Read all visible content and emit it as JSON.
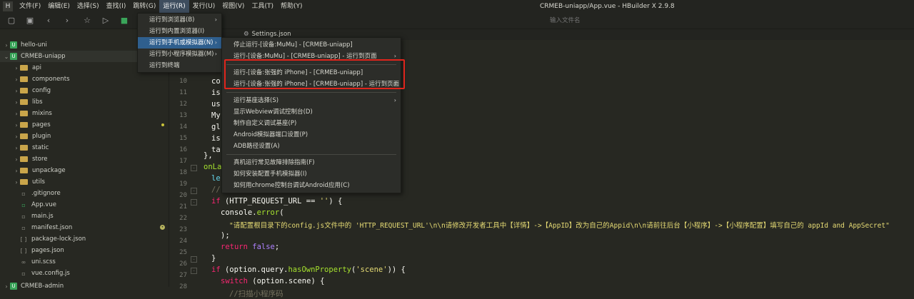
{
  "window_title": "CRMEB-uniapp/App.vue - HBuilder X 2.9.8",
  "menubar": {
    "logo": "H",
    "items": [
      "文件(F)",
      "编辑(E)",
      "选择(S)",
      "查找(I)",
      "跳转(G)",
      "运行(R)",
      "发行(U)",
      "视图(V)",
      "工具(T)",
      "帮助(Y)"
    ]
  },
  "toolbar": {
    "search_placeholder": "输入文件名"
  },
  "editor_tab": {
    "label": "Settings.json"
  },
  "sidebar": {
    "items": [
      {
        "label": "hello-uni",
        "type": "project"
      },
      {
        "label": "CRMEB-uniapp",
        "type": "project"
      },
      {
        "label": "api",
        "type": "folder"
      },
      {
        "label": "components",
        "type": "folder"
      },
      {
        "label": "config",
        "type": "folder"
      },
      {
        "label": "libs",
        "type": "folder"
      },
      {
        "label": "mixins",
        "type": "folder"
      },
      {
        "label": "pages",
        "type": "folder"
      },
      {
        "label": "plugin",
        "type": "folder"
      },
      {
        "label": "static",
        "type": "folder"
      },
      {
        "label": "store",
        "type": "folder"
      },
      {
        "label": "unpackage",
        "type": "folder"
      },
      {
        "label": "utils",
        "type": "folder"
      },
      {
        "label": ".gitignore",
        "type": "file"
      },
      {
        "label": "App.vue",
        "type": "file"
      },
      {
        "label": "main.js",
        "type": "file"
      },
      {
        "label": "manifest.json",
        "type": "file"
      },
      {
        "label": "package-lock.json",
        "type": "file"
      },
      {
        "label": "pages.json",
        "type": "file"
      },
      {
        "label": "uni.scss",
        "type": "file"
      },
      {
        "label": "vue.config.js",
        "type": "file"
      },
      {
        "label": "CRMEB-admin",
        "type": "project"
      }
    ]
  },
  "gutter": {
    "numbers": [
      "10",
      "11",
      "12",
      "13",
      "14",
      "15",
      "16",
      "17",
      "18",
      "19",
      "20",
      "21",
      "22",
      "23",
      "24",
      "25",
      "26",
      "27",
      "28",
      "29"
    ]
  },
  "code": {
    "l10": "co",
    "l11": "is",
    "l12": "us",
    "l13": "My",
    "l14": "gl",
    "l15": "is",
    "l16": "ta",
    "l17": "},",
    "l18": "onLa",
    "l19": "le",
    "l20": "//",
    "l21_kw": "if",
    "l21_a": " (HTTP_REQUEST_URL == ",
    "l21_str": "''",
    "l21_b": ") {",
    "l22_a": "console.",
    "l22_fn": "error",
    "l22_b": "(",
    "l23_str": "\"请配置根目录下的config.js文件中的 'HTTP_REQUEST_URL'\\n\\n请修改开发者工具中【详情】->【AppID】改为自己的Appid\\n\\n请前往后台【小程序】->【小程序配置】填写自己的 appId and AppSecret\"",
    "l24": ");",
    "l25_kw": "return",
    "l25_bool": " false",
    "l25_b": ";",
    "l26": "}",
    "l27_kw": "if",
    "l27_a": " (option.query.",
    "l27_fn": "hasOwnProperty",
    "l27_b": "(",
    "l27_str": "'scene'",
    "l27_c": ")) {",
    "l28_kw": "switch",
    "l28_a": " (option.scene) {",
    "l29_cmt": "//扫描小程序码"
  },
  "run_menu": {
    "items": [
      "运行到浏览器(B)",
      "运行到内置浏览器(I)",
      "运行到手机或模拟器(N)",
      "运行到小程序模拟器(M)",
      "运行到终端"
    ]
  },
  "sub_menu": {
    "group1": [
      "停止运行-[设备:MuMu] - [CRMEB-uniapp]",
      "运行-[设备:MuMu] - [CRMEB-uniapp] - 运行到页面"
    ],
    "group2": [
      "运行-[设备:张强的 iPhone] - [CRMEB-uniapp]",
      "运行-[设备:张强的 iPhone] - [CRMEB-uniapp] - 运行到页面"
    ],
    "group3": [
      "运行基座选择(S)",
      "显示Webview调试控制台(D)",
      "制作自定义调试基座(P)",
      "Android模拟器端口设置(P)",
      "ADB路径设置(A)"
    ],
    "group4": [
      "真机运行常见故障排除指南(F)",
      "如何安装配置手机模拟器(I)",
      "如何用chrome控制台调试Android应用(C)"
    ]
  },
  "colors": {
    "highlight_box": "#e0251c",
    "menu_active": "#2f5f8e",
    "project_badge": "#3aa55a",
    "folder": "#c9a54a"
  }
}
